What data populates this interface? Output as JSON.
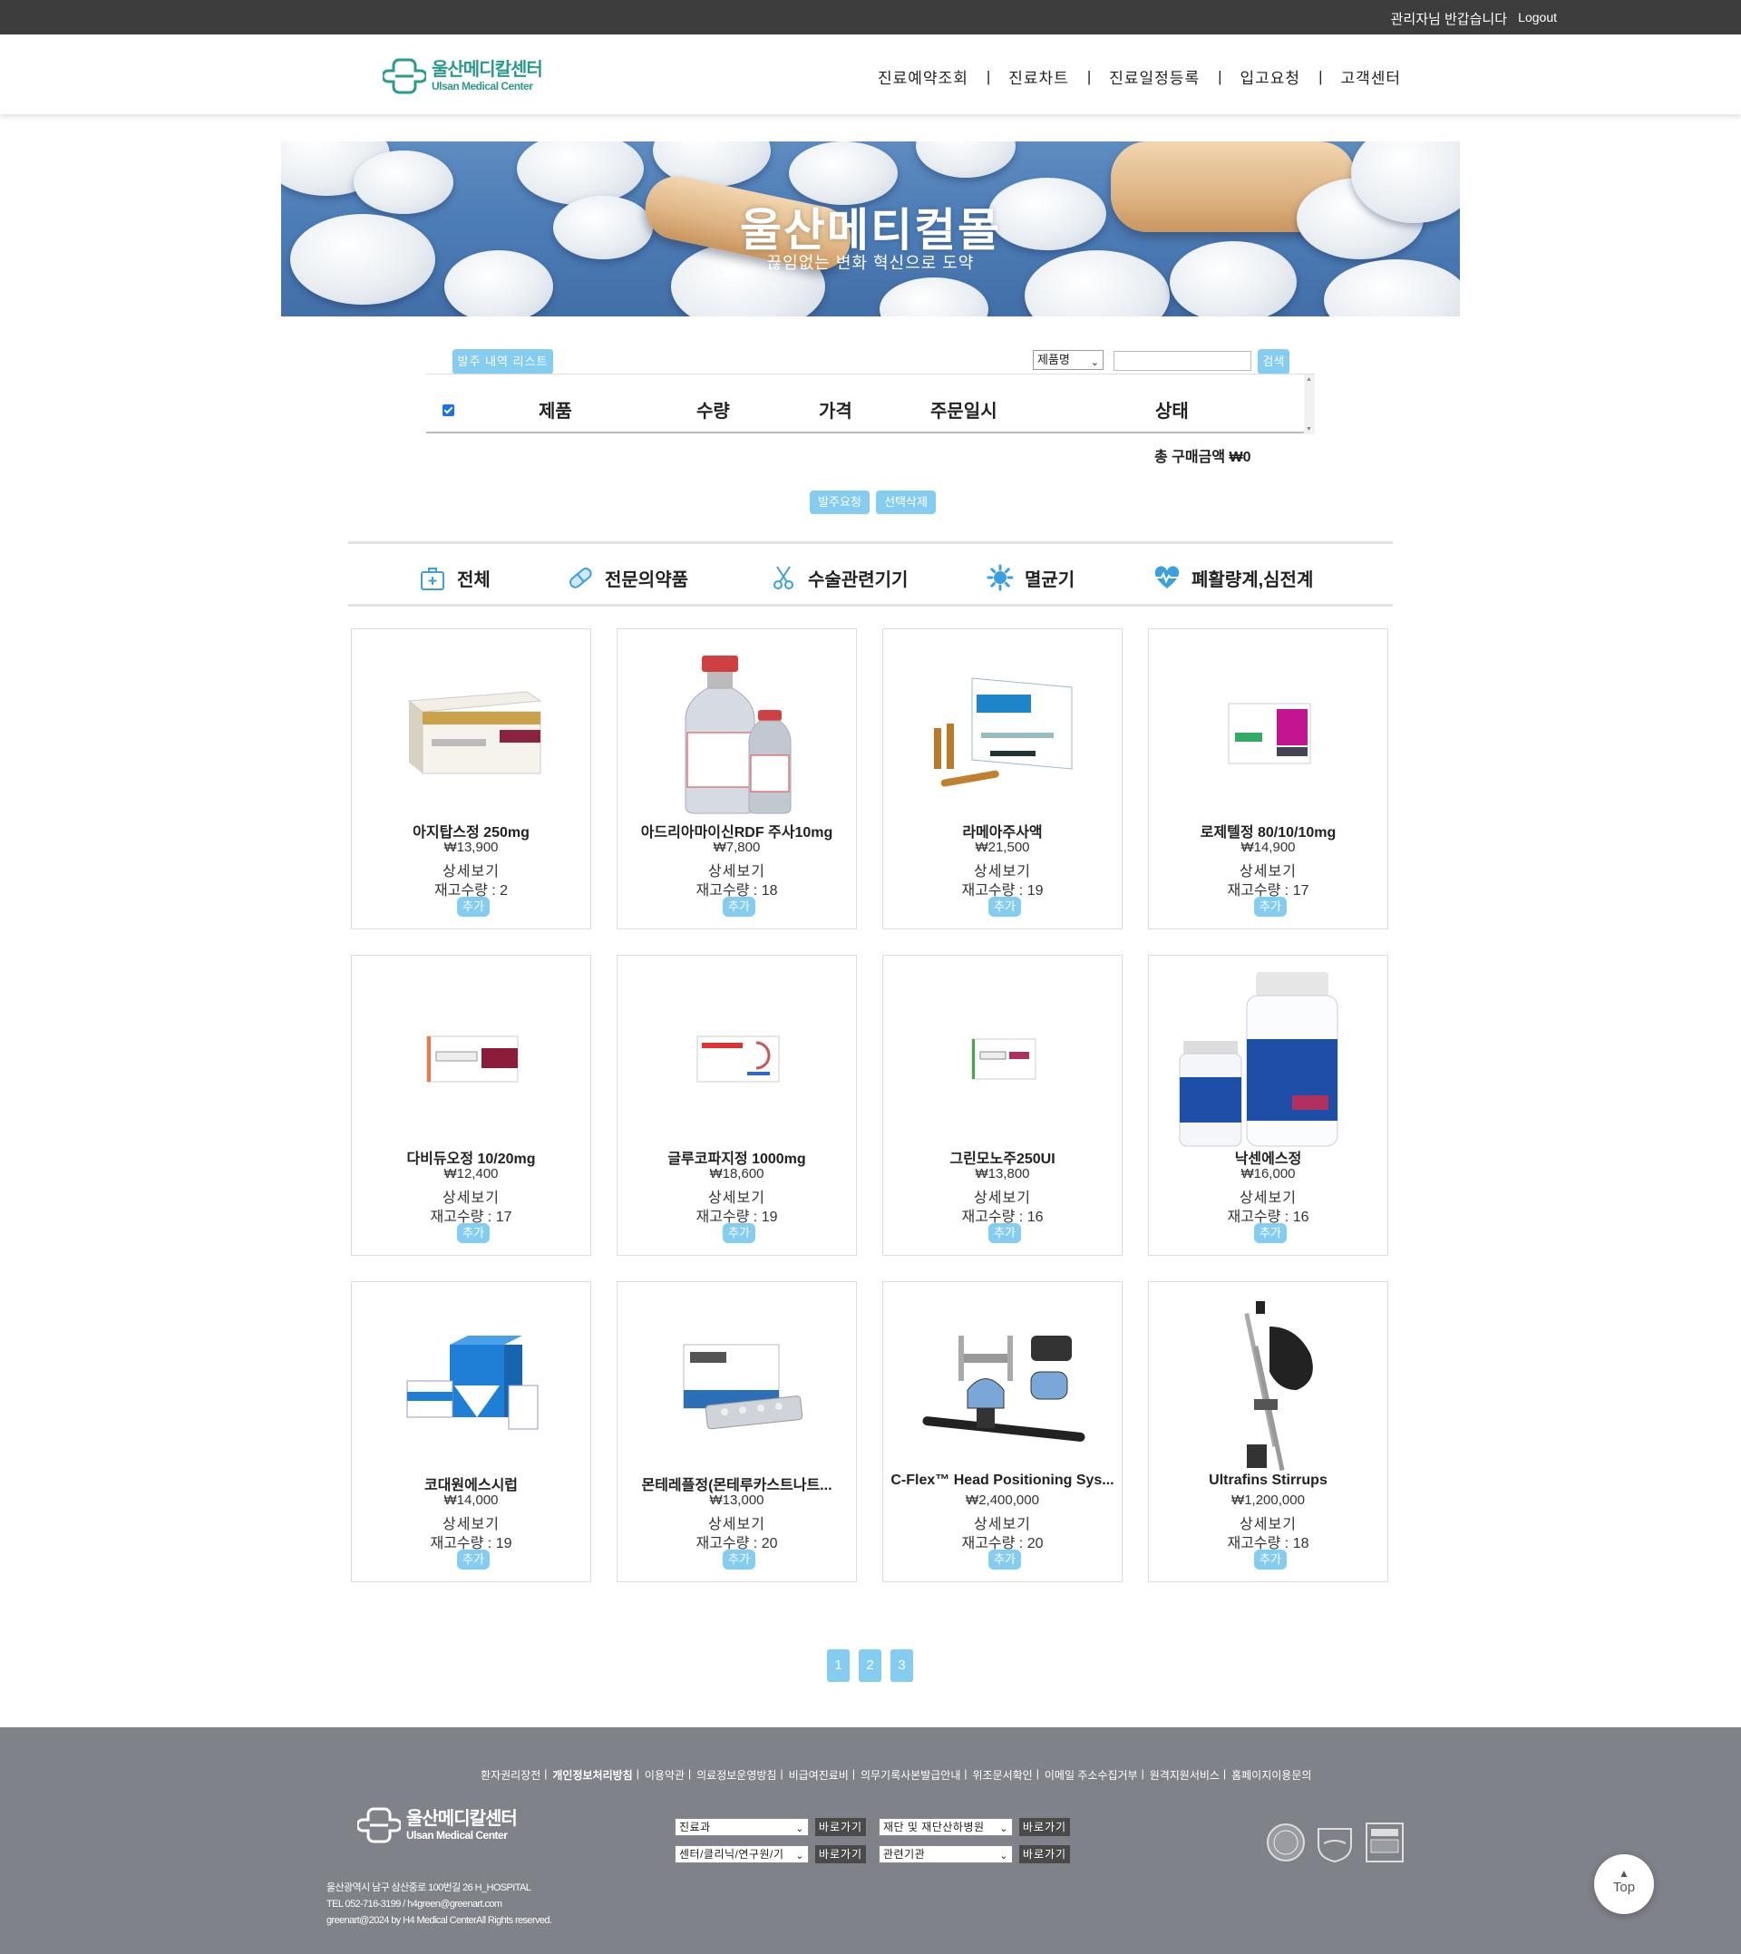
{
  "topbar": {
    "greeting": "관리자님 반갑습니다",
    "logout": "Logout"
  },
  "header": {
    "logo_ko": "울산메디칼센터",
    "logo_en": "Ulsan Medical Center",
    "nav": [
      "진료예약조회",
      "진료차트",
      "진료일정등록",
      "입고요청",
      "고객센터"
    ],
    "nav_sep": "|"
  },
  "banner": {
    "title": "울산메티컬몰",
    "subtitle": "끊임없는 변화 혁신으로 도약"
  },
  "order": {
    "list_button": "발주 내역 리스트",
    "search_select": "제품명",
    "search_button": "검색",
    "columns": [
      "제품",
      "수량",
      "가격",
      "주문일시",
      "상태"
    ],
    "total": "총 구매금액 ₩0",
    "request_button": "발주요청",
    "delete_button": "선택삭제"
  },
  "categories": [
    "전체",
    "전문의약품",
    "수술관련기기",
    "멸균기",
    "폐활량계,심전계"
  ],
  "products": [
    {
      "name": "아지탑스정 250mg",
      "price": "₩13,900",
      "detail": "상세보기",
      "stock": "재고수량 : 2",
      "add": "추가"
    },
    {
      "name": "아드리아마이신RDF 주사10mg",
      "price": "₩7,800",
      "detail": "상세보기",
      "stock": "재고수량 : 18",
      "add": "추가"
    },
    {
      "name": "라메아주사액",
      "price": "₩21,500",
      "detail": "상세보기",
      "stock": "재고수량 : 19",
      "add": "추가"
    },
    {
      "name": "로제텔정 80/10/10mg",
      "price": "₩14,900",
      "detail": "상세보기",
      "stock": "재고수량 : 17",
      "add": "추가"
    },
    {
      "name": "다비듀오정 10/20mg",
      "price": "₩12,400",
      "detail": "상세보기",
      "stock": "재고수량 : 17",
      "add": "추가"
    },
    {
      "name": "글루코파지정 1000mg",
      "price": "₩18,600",
      "detail": "상세보기",
      "stock": "재고수량 : 19",
      "add": "추가"
    },
    {
      "name": "그린모노주250UI",
      "price": "₩13,800",
      "detail": "상세보기",
      "stock": "재고수량 : 16",
      "add": "추가"
    },
    {
      "name": "낙센에스정",
      "price": "₩16,000",
      "detail": "상세보기",
      "stock": "재고수량 : 16",
      "add": "추가"
    },
    {
      "name": "코대원에스시럽",
      "price": "₩14,000",
      "detail": "상세보기",
      "stock": "재고수량 : 19",
      "add": "추가"
    },
    {
      "name": "몬테레플정(몬테루카스트나트...",
      "price": "₩13,000",
      "detail": "상세보기",
      "stock": "재고수량 : 20",
      "add": "추가"
    },
    {
      "name": "C-Flex™ Head Positioning Sys...",
      "price": "₩2,400,000",
      "detail": "상세보기",
      "stock": "재고수량 : 20",
      "add": "추가"
    },
    {
      "name": "Ultrafins Stirrups",
      "price": "₩1,200,000",
      "detail": "상세보기",
      "stock": "재고수량 : 18",
      "add": "추가"
    }
  ],
  "pagination": [
    "1",
    "2",
    "3"
  ],
  "footer": {
    "links": [
      "환자권리장전",
      "개인정보처리방침",
      "이용약관",
      "의료정보운영방침",
      "비급여진료비",
      "의무기록사본발급안내",
      "위조문서확인",
      "이메일 주소수집거부",
      "원격지원서비스",
      "홈페이지이용문의"
    ],
    "link_sep": "|",
    "logo_ko": "울산메디칼센터",
    "logo_en": "Ulsan Medical Center",
    "address": "울산광역시 남구 삼산중로 100번길 26 H_HOSPITAL",
    "tel": "TEL 052-716-3199 / h4green@greenart.com",
    "copyright": "greenart@2024 by H4 Medical CenterAll Rights reserved.",
    "selects": [
      "진료과",
      "재단 및 재단산하병원",
      "센터/클리닉/연구원/기",
      "관련기관"
    ],
    "go_button": "바로가기",
    "top_button": "Top"
  },
  "colors": {
    "accent": "#84cdf0",
    "brand": "#2a9a8c",
    "topbar": "#3d3d3d",
    "footer": "#7f8289"
  }
}
